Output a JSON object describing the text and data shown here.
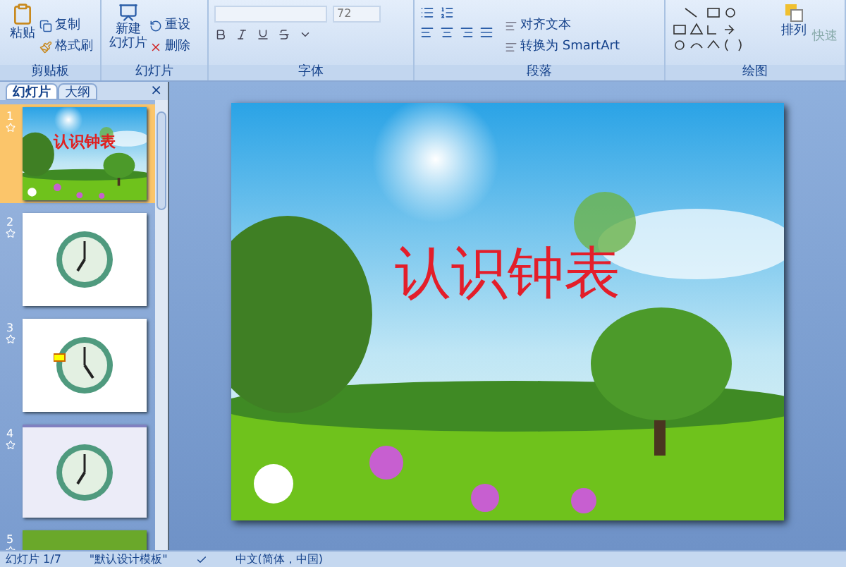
{
  "ribbon": {
    "clipboard": {
      "label": "剪贴板",
      "paste": "粘贴",
      "items": [
        "复制",
        "格式刷"
      ]
    },
    "slides": {
      "label": "幻灯片",
      "new_line1": "新建",
      "new_line2": "幻灯片",
      "items": [
        "重设",
        "删除"
      ]
    },
    "font": {
      "label": "字体",
      "size": "72"
    },
    "paragraph": {
      "label": "段落",
      "items": [
        "对齐文本",
        "转换为 SmartArt"
      ]
    },
    "drawing": {
      "label": "绘图",
      "arrange": "排列",
      "quick": "快速"
    }
  },
  "panel": {
    "tabs": [
      {
        "label": "幻灯片",
        "selected": true
      },
      {
        "label": "大纲",
        "selected": false
      }
    ],
    "close": "×",
    "slides": [
      {
        "number": "1",
        "kind": "title",
        "title": "认识钟表",
        "selected": true
      },
      {
        "number": "2",
        "kind": "clock",
        "selected": false
      },
      {
        "number": "3",
        "kind": "clock-labels",
        "selected": false
      },
      {
        "number": "4",
        "kind": "clock-page",
        "selected": false
      },
      {
        "number": "5",
        "kind": "green",
        "selected": false
      }
    ]
  },
  "slide": {
    "title": "认识钟表"
  },
  "status_bar": {
    "slide": "幻灯片 1/7",
    "theme": "\"默认设计模板\"",
    "language": "中文(简体，中国)"
  }
}
